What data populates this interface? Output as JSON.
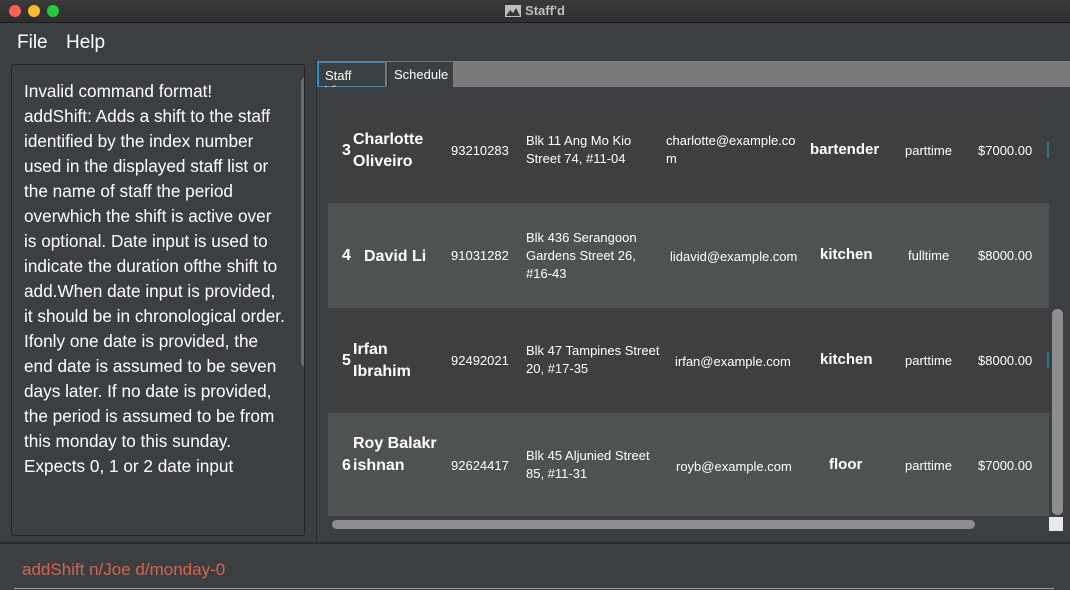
{
  "window": {
    "title": "Staff'd"
  },
  "menu": {
    "file": "File",
    "help": "Help"
  },
  "result": {
    "text": "Invalid command format!\naddShift: Adds a shift to the staff identified by the index number used in the displayed staff list or the name of staff the period overwhich the shift is active over is optional. Date input is used to indicate the duration ofthe shift to add.When date input is provided, it should be in chronological order. Ifonly one date is provided, the end date is assumed to be seven days later. If no date is provided, the period is assumed to be from this monday to this sunday. Expects 0, 1 or 2 date input"
  },
  "tabs": [
    {
      "label": "Staff View",
      "selected": true
    },
    {
      "label": "Schedule",
      "selected": false
    }
  ],
  "staff": [
    {
      "index": "3",
      "name": "Charlotte Oliveiro",
      "phone": "93210283",
      "address": "Blk 11 Ang Mo Kio Street 74, #11-04",
      "email": "charlotte@example.co m",
      "role": "bartender",
      "type": "parttime",
      "salary": "$7000.00"
    },
    {
      "index": "4",
      "name": "David Li",
      "phone": "91031282",
      "address": "Blk 436 Serangoon Gardens Street 26, #16-43",
      "email": "lidavid@example.com",
      "role": "kitchen",
      "type": "fulltime",
      "salary": "$8000.00"
    },
    {
      "index": "5",
      "name": "Irfan Ibrahim",
      "phone": "92492021",
      "address": "Blk 47 Tampines Street 20, #17-35",
      "email": "irfan@example.com",
      "role": "kitchen",
      "type": "parttime",
      "salary": "$8000.00"
    },
    {
      "index": "6",
      "name": "Roy Balakrishnan",
      "phone": "92624417",
      "address": "Blk 45 Aljunied Street 85, #11-31",
      "email": "royb@example.com",
      "role": "floor",
      "type": "parttime",
      "salary": "$7000.00"
    }
  ],
  "command": {
    "value": "addShift n/Joe d/monday-0"
  },
  "colors": {
    "background": "#3c3f41",
    "row_dark": "#3e3f40",
    "row_light": "#4e5253",
    "tab_focus": "#2d8fd5",
    "command_error": "#d9614b"
  },
  "icons": {
    "title_logo": "mountain-logo-icon"
  }
}
